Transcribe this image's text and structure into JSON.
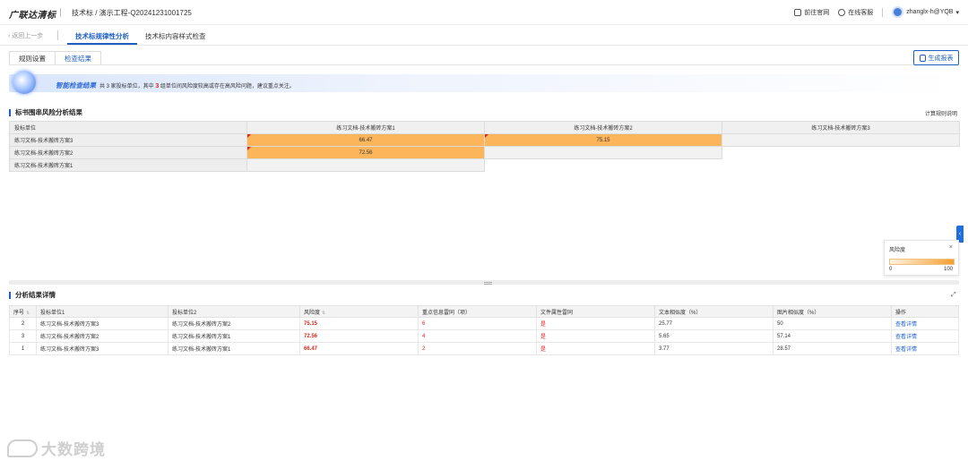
{
  "header": {
    "logo": "广联达清标",
    "breadcrumb": "技术标 / 演示工程-Q20241231001725",
    "links": [
      {
        "label": "前往官网",
        "icon": "home-icon"
      },
      {
        "label": "在线客服",
        "icon": "headset-icon"
      }
    ],
    "user": "zhanglx-h@YQB"
  },
  "nav": {
    "back": "返回上一步",
    "tabs": [
      "技术标规律性分析",
      "技术标内容样式检查"
    ],
    "active_tab": 0
  },
  "subtabs": [
    "规则设置",
    "检查结果"
  ],
  "active_subtab": 1,
  "report_button": "生成报表",
  "banner": {
    "title": "智能检查结果",
    "text_pre": "共 3 家投标单位，其中 ",
    "count": "3",
    "text_post": " 组单位间风险度较高或存在高风险问题，建议重点关注。"
  },
  "risk_section": {
    "title": "标书围串风险分析结果",
    "calc_link": "计算规则说明",
    "corner_label": "投标单位",
    "columns": [
      "练习文档-技术搬砖方案1",
      "练习文档-技术搬砖方案2",
      "练习文档-技术搬砖方案3"
    ],
    "rows": [
      {
        "label": "练习文档-技术搬砖方案3",
        "cells": [
          "66.47",
          "75.15",
          ""
        ]
      },
      {
        "label": "练习文档-技术搬砖方案2",
        "cells": [
          "72.56",
          ""
        ]
      },
      {
        "label": "练习文档-技术搬砖方案1",
        "cells": [
          ""
        ]
      }
    ]
  },
  "legend": {
    "title": "风险度",
    "min": "0",
    "max": "100",
    "colors": [
      "#fff3e0",
      "#f5a030"
    ]
  },
  "details": {
    "title": "分析结果详情",
    "headers": [
      "序号",
      "投标单位1",
      "投标单位2",
      "风险度",
      "重点信息雷同（项）",
      "文件属性雷同",
      "文本相似度（%）",
      "图片相似度（%）",
      "操作"
    ],
    "rows": [
      {
        "no": "2",
        "unit1": "练习文档-技术搬砖方案3",
        "unit2": "练习文档-技术搬砖方案2",
        "risk": "75.15",
        "key": "6",
        "attr": "是",
        "text": "25.77",
        "img": "50",
        "op": "查看详情"
      },
      {
        "no": "3",
        "unit1": "练习文档-技术搬砖方案2",
        "unit2": "练习文档-技术搬砖方案1",
        "risk": "72.56",
        "key": "4",
        "attr": "是",
        "text": "5.65",
        "img": "57.14",
        "op": "查看详情"
      },
      {
        "no": "1",
        "unit1": "练习文档-技术搬砖方案3",
        "unit2": "练习文档-技术搬砖方案1",
        "risk": "66.47",
        "key": "2",
        "attr": "是",
        "text": "3.77",
        "img": "28.57",
        "op": "查看详情"
      }
    ]
  },
  "watermark": "大数跨境"
}
